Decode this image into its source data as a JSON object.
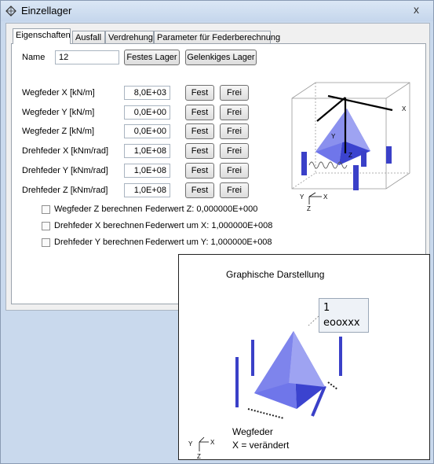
{
  "window": {
    "title": "Einzellager",
    "close_glyph": "x"
  },
  "tabs": [
    {
      "label": "Eigenschaften",
      "active": true
    },
    {
      "label": "Ausfall",
      "active": false
    },
    {
      "label": "Verdrehung",
      "active": false
    },
    {
      "label": "Parameter für Federberechnung",
      "active": false
    }
  ],
  "name_row": {
    "label": "Name",
    "value": "12",
    "fest_button": "Festes Lager",
    "gelenk_button": "Gelenkiges Lager"
  },
  "springs": [
    {
      "label": "Wegfeder X [kN/m]",
      "value": "8,0E+03",
      "fest": "Fest",
      "frei": "Frei"
    },
    {
      "label": "Wegfeder Y [kN/m]",
      "value": "0,0E+00",
      "fest": "Fest",
      "frei": "Frei"
    },
    {
      "label": "Wegfeder Z [kN/m]",
      "value": "0,0E+00",
      "fest": "Fest",
      "frei": "Frei"
    },
    {
      "label": "Drehfeder X [kNm/rad]",
      "value": "1,0E+08",
      "fest": "Fest",
      "frei": "Frei"
    },
    {
      "label": "Drehfeder Y [kNm/rad]",
      "value": "1,0E+08",
      "fest": "Fest",
      "frei": "Frei"
    },
    {
      "label": "Drehfeder Z [kNm/rad]",
      "value": "1,0E+08",
      "fest": "Fest",
      "frei": "Frei"
    }
  ],
  "checks": [
    {
      "label": "Wegfeder Z berechnen",
      "checked": false,
      "info": "Federwert Z: 0,000000E+000"
    },
    {
      "label": "Drehfeder X berechnen",
      "checked": false,
      "info": "Federwert um X: 1,000000E+008"
    },
    {
      "label": "Drehfeder Y berechnen",
      "checked": false,
      "info": "Federwert um Y: 1,000000E+008"
    }
  ],
  "preview_axes": {
    "x": "X",
    "y": "Y",
    "z": "Z"
  },
  "popup": {
    "title": "Graphische Darstellung",
    "callout_line1": "1",
    "callout_line2": "eooxxx",
    "caption1": "Wegfeder",
    "caption2": "X = verändert",
    "axes": {
      "x": "X",
      "y": "Y",
      "z": "Z"
    }
  },
  "colors": {
    "pyramid": "#5a62e6",
    "pyramid_dark": "#2f37c4",
    "frame": "#c9d9ed",
    "accent_blue": "#3a40c8"
  }
}
